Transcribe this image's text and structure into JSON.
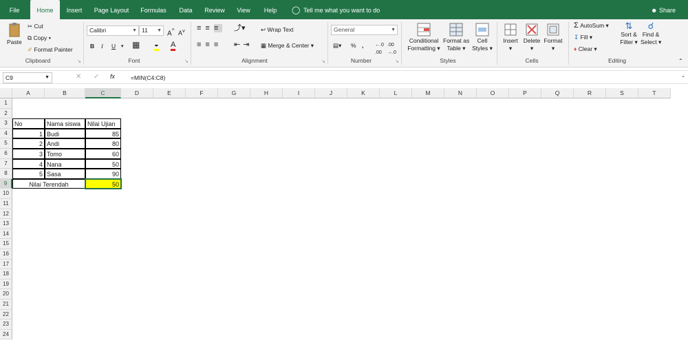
{
  "tabs": [
    "File",
    "Home",
    "Insert",
    "Page Layout",
    "Formulas",
    "Data",
    "Review",
    "View",
    "Help"
  ],
  "tell_me": "Tell me what you want to do",
  "share": "Share",
  "clipboard": {
    "paste": "Paste",
    "cut": "Cut",
    "copy": "Copy",
    "format_painter": "Format Painter",
    "label": "Clipboard"
  },
  "font": {
    "name": "Calibri",
    "size": "11",
    "label": "Font",
    "bold": "B",
    "italic": "I",
    "underline": "U"
  },
  "alignment": {
    "wrap": "Wrap Text",
    "merge": "Merge & Center",
    "label": "Alignment"
  },
  "number": {
    "format": "General",
    "percent": "%",
    "label": "Number"
  },
  "styles": {
    "conditional": "Conditional",
    "conditional2": "Formatting",
    "format_as": "Format as",
    "format_as2": "Table",
    "cell": "Cell",
    "cell2": "Styles",
    "label": "Styles"
  },
  "cells": {
    "insert": "Insert",
    "delete": "Delete",
    "format": "Format",
    "label": "Cells"
  },
  "editing": {
    "autosum": "AutoSum",
    "fill": "Fill",
    "clear": "Clear",
    "sort": "Sort &",
    "sort2": "Filter",
    "find": "Find &",
    "find2": "Select",
    "label": "Editing"
  },
  "formula_bar": {
    "name_box": "C9",
    "fx": "fx",
    "formula": "=MIN(C4:C8)"
  },
  "columns": [
    "A",
    "B",
    "C",
    "D",
    "E",
    "F",
    "G",
    "H",
    "I",
    "J",
    "K",
    "L",
    "M",
    "N",
    "O",
    "P",
    "Q",
    "R",
    "S",
    "T"
  ],
  "rows": [
    "1",
    "2",
    "3",
    "4",
    "5",
    "6",
    "7",
    "8",
    "9",
    "10",
    "11",
    "12",
    "13",
    "14",
    "15",
    "16",
    "17",
    "18",
    "19",
    "20",
    "21",
    "22",
    "23",
    "24"
  ],
  "table": {
    "headers": [
      "No",
      "Nama siswa",
      "Nilai Ujian"
    ],
    "rows": [
      [
        "1",
        "Budi",
        "85"
      ],
      [
        "2",
        "Andi",
        "80"
      ],
      [
        "3",
        "Tomo",
        "60"
      ],
      [
        "4",
        "Nana",
        "50"
      ],
      [
        "5",
        "Sasa",
        "90"
      ]
    ],
    "summary_label": "Nilai Terendah",
    "summary_value": "50"
  },
  "colors": {
    "brand": "#217346",
    "highlight": "#ffff00"
  }
}
